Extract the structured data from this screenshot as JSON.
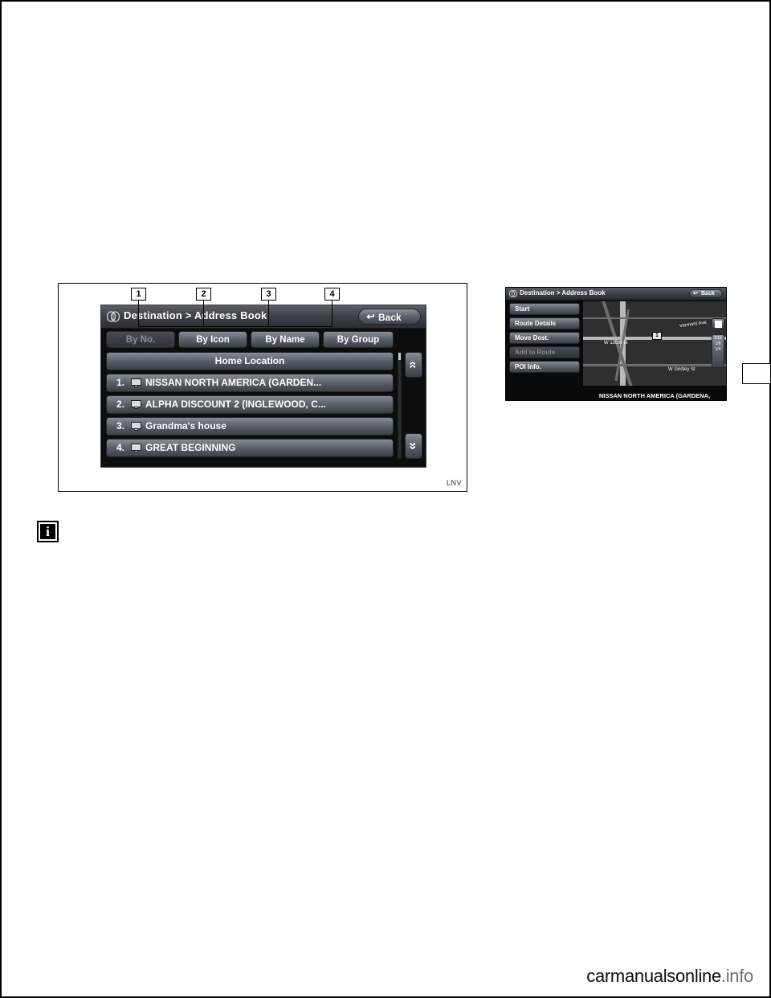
{
  "figure_main": {
    "header": {
      "icon": "compass-icon",
      "title": "Destination > Address Book",
      "back_label": "Back",
      "back_arrow": "↩"
    },
    "tabs": [
      {
        "label": "By No.",
        "state": "disabled"
      },
      {
        "label": "By Icon",
        "state": "enabled"
      },
      {
        "label": "By Name",
        "state": "enabled"
      },
      {
        "label": "By Group",
        "state": "enabled"
      }
    ],
    "list": [
      {
        "num": "",
        "label": "Home Location",
        "icon": ""
      },
      {
        "num": "1.",
        "label": "NISSAN NORTH AMERICA (GARDEN...",
        "icon": "monitor-icon"
      },
      {
        "num": "2.",
        "label": "ALPHA DISCOUNT 2 (INGLEWOOD, C...",
        "icon": "monitor-icon"
      },
      {
        "num": "3.",
        "label": "Grandma's house",
        "icon": "monitor-icon"
      },
      {
        "num": "4.",
        "label": "GREAT BEGINNING",
        "icon": "monitor-icon"
      }
    ],
    "scroll": {
      "up_arrow": "«",
      "down_arrow": "»"
    },
    "callouts": [
      "1",
      "2",
      "3",
      "4"
    ],
    "figure_code": "LNV"
  },
  "info_icon": {
    "glyph": "i"
  },
  "figure_right": {
    "header": {
      "icon": "compass-icon",
      "title": "Destination > Address Book",
      "back_label": "Back",
      "back_arrow": "↩"
    },
    "menu": [
      {
        "label": "Start",
        "state": "enabled"
      },
      {
        "label": "Route Details",
        "state": "enabled"
      },
      {
        "label": "Move Dest.",
        "state": "enabled"
      },
      {
        "label": "Add to Route",
        "state": "disabled"
      },
      {
        "label": "POI Info.",
        "state": "enabled"
      }
    ],
    "map": {
      "marker": "1",
      "street_labels": [
        "Vermont Ave",
        "W 135th St",
        "W Gridley St"
      ],
      "save_button": "save-icon",
      "zoom_labels": [
        "1/16",
        "1/8",
        "1/4"
      ]
    },
    "caption": "NISSAN NORTH AMERICA (GARDENA,"
  },
  "footer": {
    "watermark_main": "carmanualsonline",
    "watermark_suffix": ".info"
  }
}
